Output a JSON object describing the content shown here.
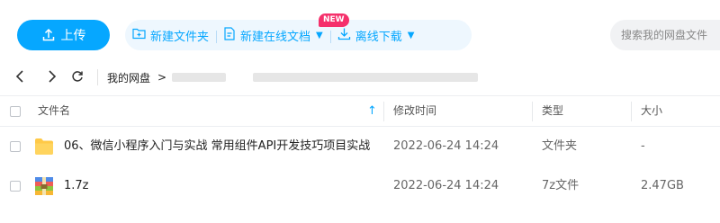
{
  "toolbar": {
    "upload_label": "上传",
    "new_folder_label": "新建文件夹",
    "new_online_doc_label": "新建在线文档",
    "new_badge": "NEW",
    "offline_download_label": "离线下载",
    "search_placeholder": "搜索我的网盘文件",
    "accent_color": "#06a7ff"
  },
  "breadcrumb": {
    "root": "我的网盘",
    "separator": ">"
  },
  "table": {
    "columns": [
      "文件名",
      "修改时间",
      "类型",
      "大小"
    ],
    "rows": [
      {
        "icon": "folder-icon",
        "name": "06、微信小程序入门与实战 常用组件API开发技巧项目实战",
        "modified": "2022-06-24 14:24",
        "type": "文件夹",
        "size": "-"
      },
      {
        "icon": "archive-file-icon",
        "name": "1.7z",
        "modified": "2022-06-24 14:24",
        "type": "7z文件",
        "size": "2.47GB"
      }
    ]
  }
}
